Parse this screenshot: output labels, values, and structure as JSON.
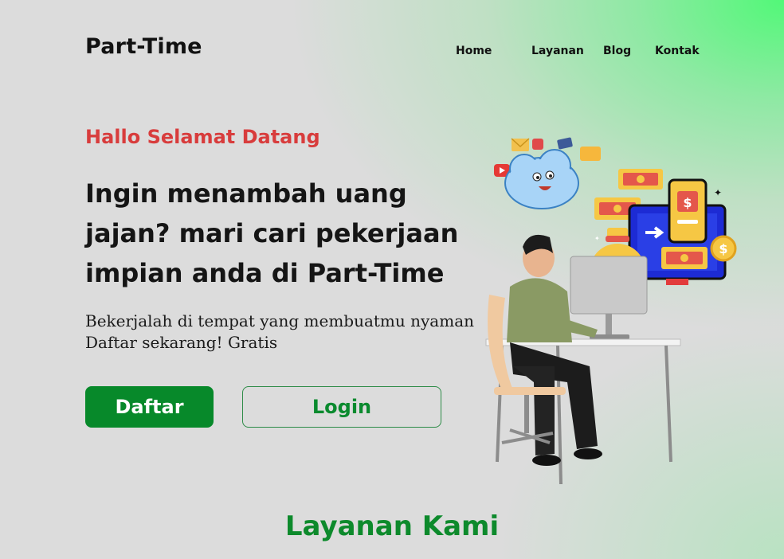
{
  "header": {
    "logo": "Part-Time",
    "nav": [
      {
        "label": "Home"
      },
      {
        "label": "Layanan"
      },
      {
        "label": "Blog"
      },
      {
        "label": "Kontak"
      }
    ]
  },
  "hero": {
    "greeting": "Hallo Selamat Datang",
    "headline_lines": [
      "Ingin menambah uang",
      "jajan? mari cari pekerjaan",
      "impian anda di Part-Time"
    ],
    "sub_lines": [
      "Bekerjalah di tempat yang membuatmu nyaman",
      "Daftar sekarang! Gratis"
    ],
    "buttons": {
      "daftar": "Daftar",
      "login": "Login"
    },
    "illustration_currency": "$"
  },
  "services": {
    "title": "Layanan Kami"
  },
  "colors": {
    "greeting": "#d83c3c",
    "primary_green": "#07892a",
    "accent_glow": "#52f878"
  }
}
